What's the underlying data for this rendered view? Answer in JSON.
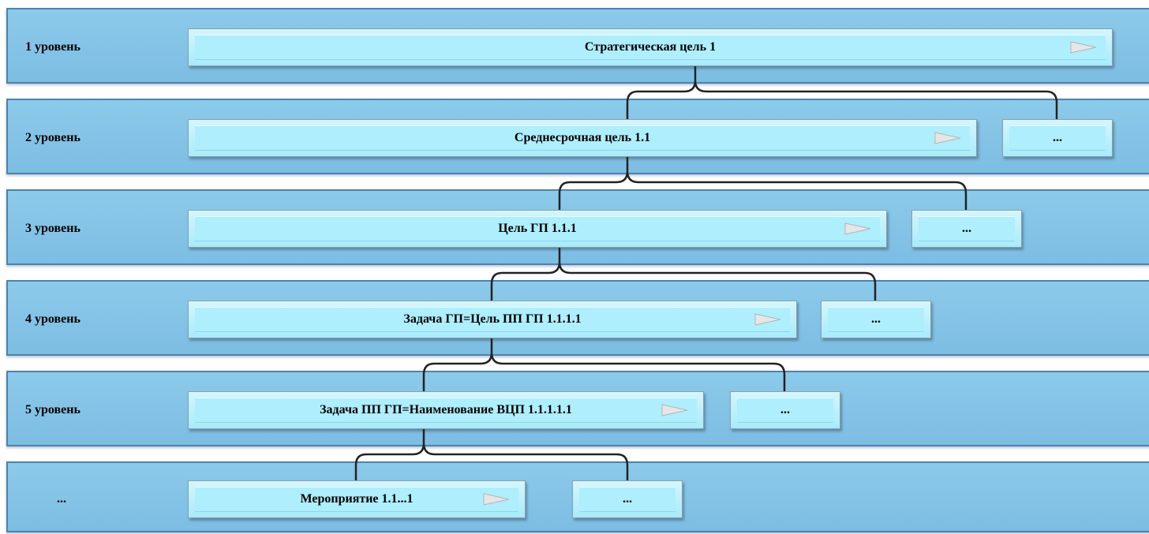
{
  "levels": [
    {
      "label": "1 уровень",
      "main": "Стратегическая цель 1",
      "extra": ""
    },
    {
      "label": "2 уровень",
      "main": "Среднесрочная цель 1.1",
      "extra": "..."
    },
    {
      "label": "3 уровень",
      "main": "Цель ГП 1.1.1",
      "extra": "..."
    },
    {
      "label": "4 уровень",
      "main": "Задача ГП=Цель ПП ГП 1.1.1.1",
      "extra": "..."
    },
    {
      "label": "5 уровень",
      "main": "Задача ПП ГП=Наименование ВЦП 1.1.1.1.1",
      "extra": "..."
    },
    {
      "label": "...",
      "main": "Мероприятие 1.1...1",
      "extra": "..."
    }
  ],
  "colors": {
    "band": "#85c4e7",
    "band_border": "#4d82ad",
    "node": "#aeeefd",
    "connector": "#222222",
    "arrow": "#e6e6e6"
  }
}
